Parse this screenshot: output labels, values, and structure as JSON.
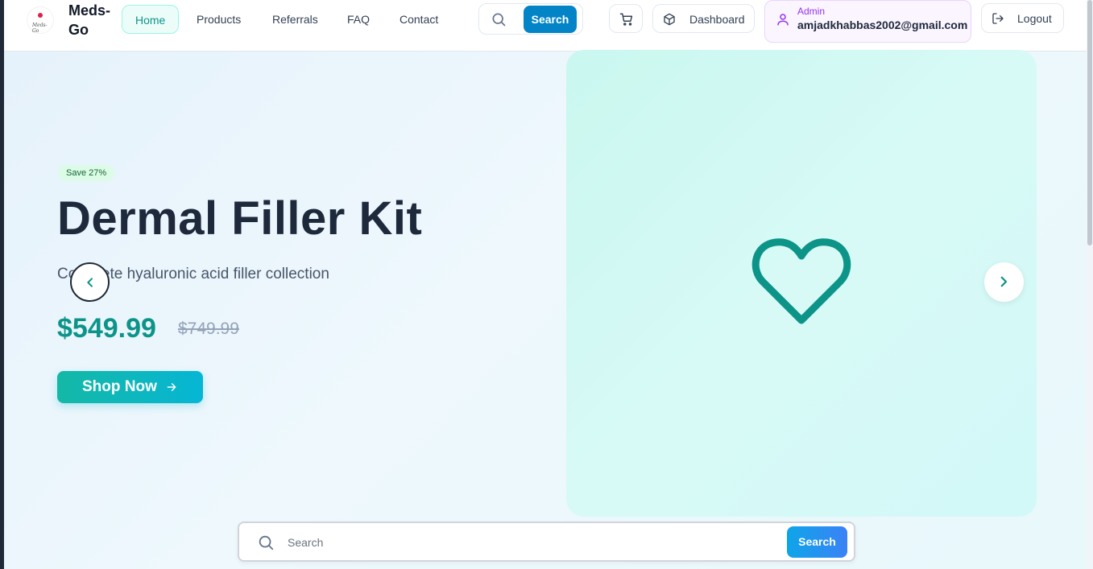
{
  "header": {
    "brand": "Meds-Go",
    "logo_text": "Meds-Go",
    "nav": [
      {
        "label": "Home",
        "active": true
      },
      {
        "label": "Products",
        "active": false
      },
      {
        "label": "Referrals",
        "active": false
      },
      {
        "label": "FAQ",
        "active": false
      },
      {
        "label": "Contact",
        "active": false
      }
    ],
    "search_button": "Search",
    "dashboard_label": "Dashboard",
    "user": {
      "role": "Admin",
      "email": "amjadkhabbas2002@gmail.com"
    },
    "logout_label": "Logout"
  },
  "hero": {
    "badge": "Save 27%",
    "title": "Dermal Filler Kit",
    "subtitle": "Complete hyaluronic acid filler collection",
    "price_current": "$549.99",
    "price_original": "$749.99",
    "cta_label": "Shop Now",
    "image_icon": "heart-icon"
  },
  "bottom_search": {
    "placeholder": "Search",
    "button": "Search"
  },
  "colors": {
    "accent": "#0d9488",
    "primary_blue": "#0284c7",
    "admin": "#9333ea"
  }
}
